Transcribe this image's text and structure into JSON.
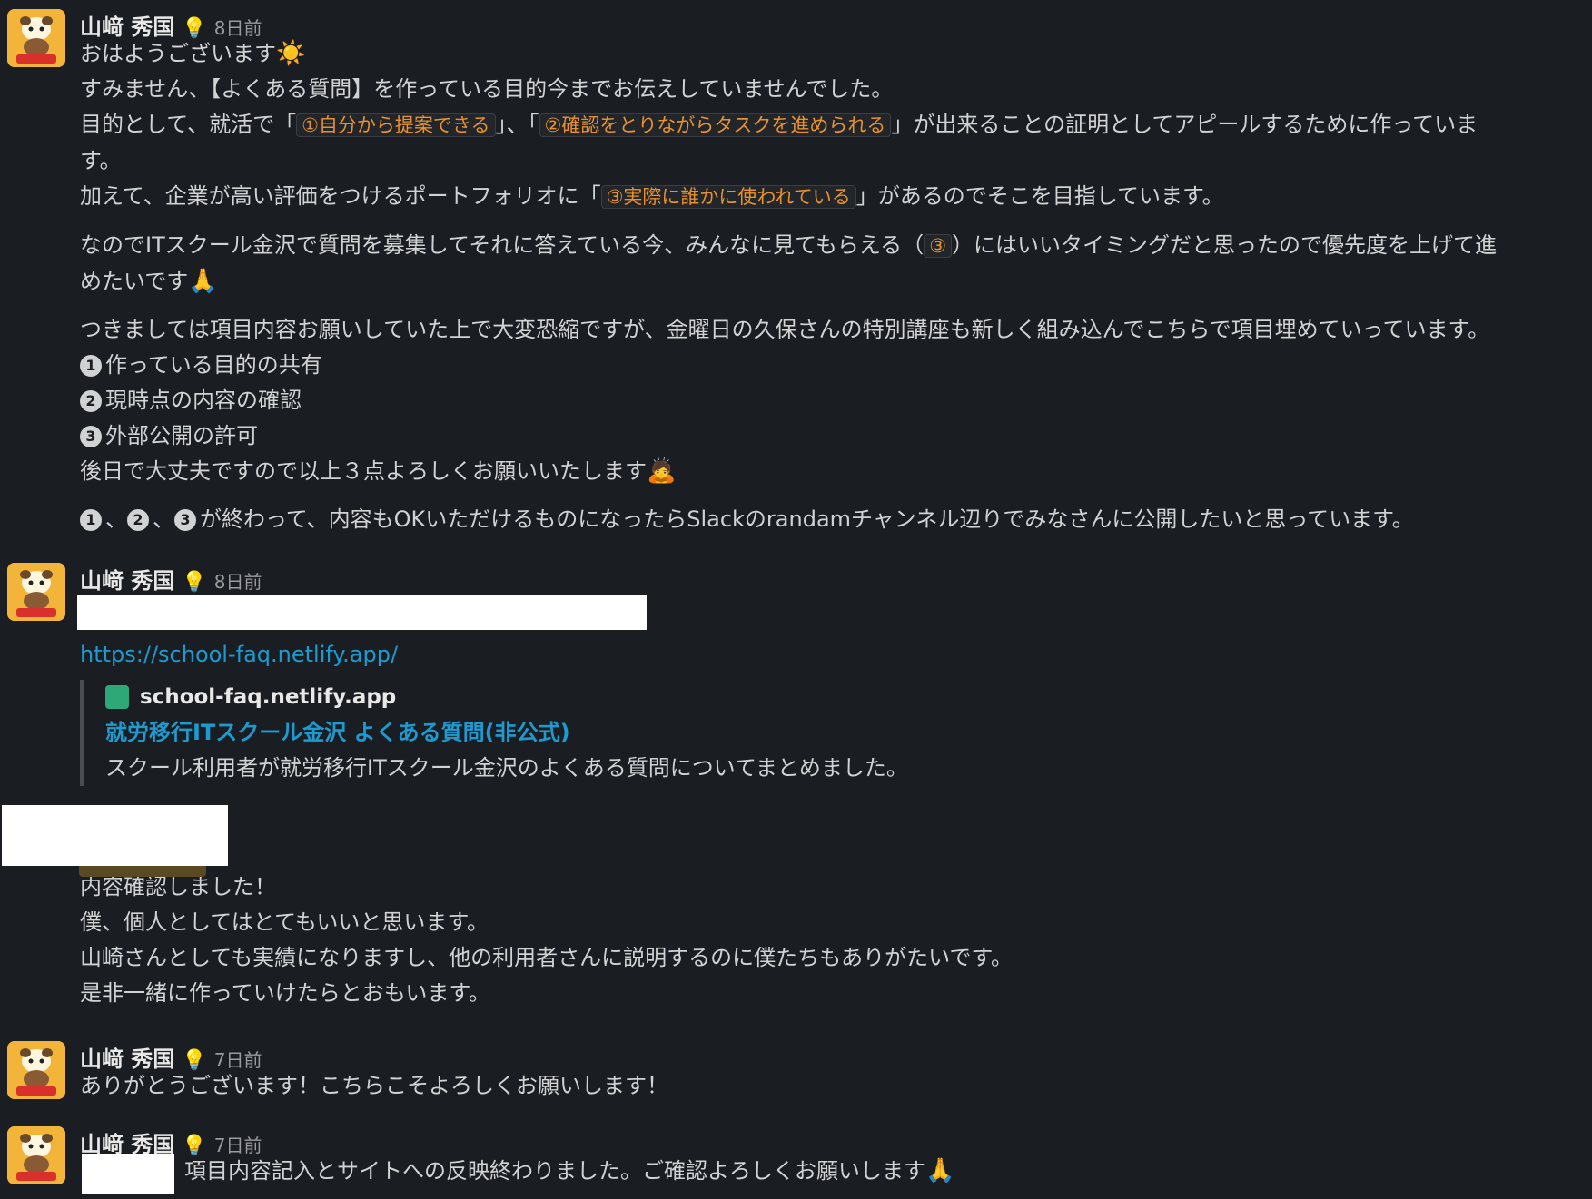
{
  "messages": [
    {
      "author": "山﨑 秀国",
      "status_icon": "lightbulb-icon",
      "time": "8日前",
      "lines": {
        "l1": "おはようございます",
        "l2": "すみません、【よくある質問】を作っている目的今までお伝えしていませんでした。",
        "l3a": "目的として、就活で「",
        "l3b": "①自分から提案できる",
        "l3c": "」、「",
        "l3d": "②確認をとりながらタスクを進められる",
        "l3e": "」が出来ることの証明としてアピールするために作っていま",
        "l4": "す。",
        "l5a": "加えて、企業が高い評価をつけるポートフォリオに「",
        "l5b": "③実際に誰かに使われている",
        "l5c": "」があるのでそこを目指しています。",
        "l6a": "なのでITスクール金沢で質問を募集してそれに答えている今、みんなに見てもらえる（",
        "l6b": "③",
        "l6c": "）にはいいタイミングだと思ったので優先度を上げて進",
        "l7": "めたいです",
        "l8": "つきましては項目内容お願いしていた上で大変恐縮ですが、金曜日の久保さんの特別講座も新しく組み込んでこちらで項目埋めていっています。",
        "item1": "作っている目的の共有",
        "item2": "現時点の内容の確認",
        "item3": "外部公開の許可",
        "l9": "後日で大丈夫ですので以上３点よろしくお願いいたします",
        "l10": "が終わって、内容もOKいただけるものになったらSlackのrandamチャンネル辺りでみなさんに公開したいと思っています。",
        "sep": "、"
      },
      "numbers": [
        "1",
        "2",
        "3"
      ]
    },
    {
      "author": "山﨑 秀国",
      "time": "8日前",
      "link": "https://school-faq.netlify.app/",
      "unfurl": {
        "site": "school-faq.netlify.app",
        "title": "就労移行ITスクール金沢 よくある質問(非公式)",
        "description": "スクール利用者が就労移行ITスクール金沢のよくある質問についてまとめました。"
      }
    },
    {
      "lines": [
        "内容確認しました！",
        "僕、個人としてはとてもいいと思います。",
        "山崎さんとしても実績になりますし、他の利用者さんに説明するのに僕たちもありがたいです。",
        "是非一緒に作っていけたらとおもいます。"
      ]
    },
    {
      "author": "山﨑 秀国",
      "time": "7日前",
      "text": "ありがとうございます！こちらこそよろしくお願いします！"
    },
    {
      "author": "山﨑 秀国",
      "time": "7日前",
      "text": "項目内容記入とサイトへの反映終わりました。ご確認よろしくお願いします"
    }
  ],
  "emojis": {
    "sun": "☀️",
    "pray": "🙏",
    "bow": "🙇",
    "bulb": "💡"
  },
  "colors": {
    "background": "#1a1d21",
    "text": "#d1d2d3",
    "link": "#1d9bd1",
    "code": "#e8912d"
  }
}
